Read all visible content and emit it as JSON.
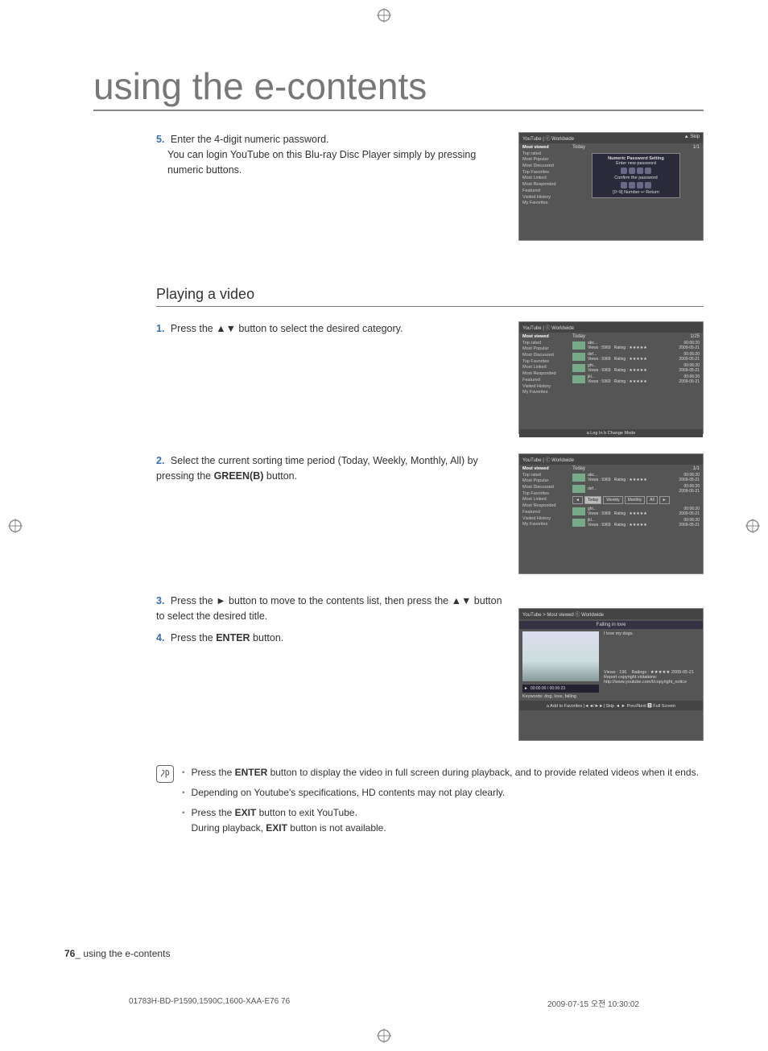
{
  "page_title": "using the e-contents",
  "step5": {
    "num": "5.",
    "text_a": "Enter the 4-digit numeric password.",
    "text_b": "You can login YouTube on this Blu-ray Disc Player simply by pressing numeric buttons."
  },
  "section_title": "Playing a video",
  "step1": {
    "num": "1.",
    "text": "Press the ▲▼ button to select the desired category."
  },
  "step2": {
    "num": "2.",
    "text_a": "Select the current sorting time period (Today, Weekly, Monthly, All) by pressing the ",
    "text_b": "GREEN(B)",
    "text_c": " button."
  },
  "step3": {
    "num": "3.",
    "text": "Press the ► button to move to the contents list, then press the ▲▼ button to select the desired title."
  },
  "step4": {
    "num": "4.",
    "text_a": "Press the ",
    "text_b": "ENTER",
    "text_c": " button."
  },
  "notes": {
    "n1_a": "Press the ",
    "n1_b": "ENTER",
    "n1_c": " button to display the video in full screen during playback, and to provide related videos when it ends.",
    "n2": "Depending on Youtube's specifications, HD contents may not play clearly.",
    "n3_a": "Press the ",
    "n3_b": "EXIT",
    "n3_c": " button to exit YouTube.",
    "n3_d": "During playback, ",
    "n3_e": "EXIT",
    "n3_f": " button is not available."
  },
  "footer": {
    "page_num": "76",
    "label": "_ using the e-contents"
  },
  "print_footer": {
    "left": "01783H-BD-P1590,1590C,1600-XAA-E76   76",
    "right": "2009-07-15   오전 10:30:02"
  },
  "yt": {
    "header": "YouTube | ⓒ Worldwide",
    "side": [
      "Most viewed",
      "Top rated",
      "Most Popular",
      "Most Discussed",
      "Top Favorites",
      "Most Linked",
      "Most Responded",
      "Featured",
      "Visited History",
      "My Favorites"
    ],
    "today": "Today",
    "page_a": "1/1",
    "page_b": "1/25",
    "page_c": "1/1",
    "skip": "▲ Skip",
    "dialog": {
      "title": "Numeric Password Setting",
      "enter": "Enter new password",
      "confirm": "Confirm the password",
      "hint": "[0~9] Number   ↩ Return"
    },
    "items": [
      {
        "title": "abc...",
        "views": "Views : 5969",
        "rating": "Rating : ★★★★★",
        "dur": "00:06:20",
        "date": "2009-05-21"
      },
      {
        "title": "def...",
        "views": "Views : 5969",
        "rating": "Rating : ★★★★★",
        "dur": "00:06:20",
        "date": "2009-05-21"
      },
      {
        "title": "ghi...",
        "views": "Views : 5969",
        "rating": "Rating : ★★★★★",
        "dur": "00:06:20",
        "date": "2009-05-21"
      },
      {
        "title": "jkl...",
        "views": "Views : 5969",
        "rating": "Rating : ★★★★★",
        "dur": "00:06:20",
        "date": "2009-05-21"
      }
    ],
    "sort_opts": [
      "Today",
      "Weekly",
      "Monthly",
      "All"
    ],
    "footer_b": "a Log In   b Change Mode",
    "play": {
      "breadcrumb": "YouTube > Most viewed      ⓒ Worldwide",
      "title": "Falling in love",
      "desc": "I love my dogs.",
      "views": "Views : 196",
      "ratings": "Ratings : ★★★★★ 2009-05-21",
      "report": "Report copyright violations:",
      "url": "http://www.youtube.com/t/copyright_notice",
      "time": "00:00:00 / 00:06:23",
      "keywords": "Keywords: dog, love, falling",
      "footer": "a Add to Favorites   |◄◄/►►| Skip   ◄ ► Prev/Next    🅳 Full Screen"
    }
  }
}
